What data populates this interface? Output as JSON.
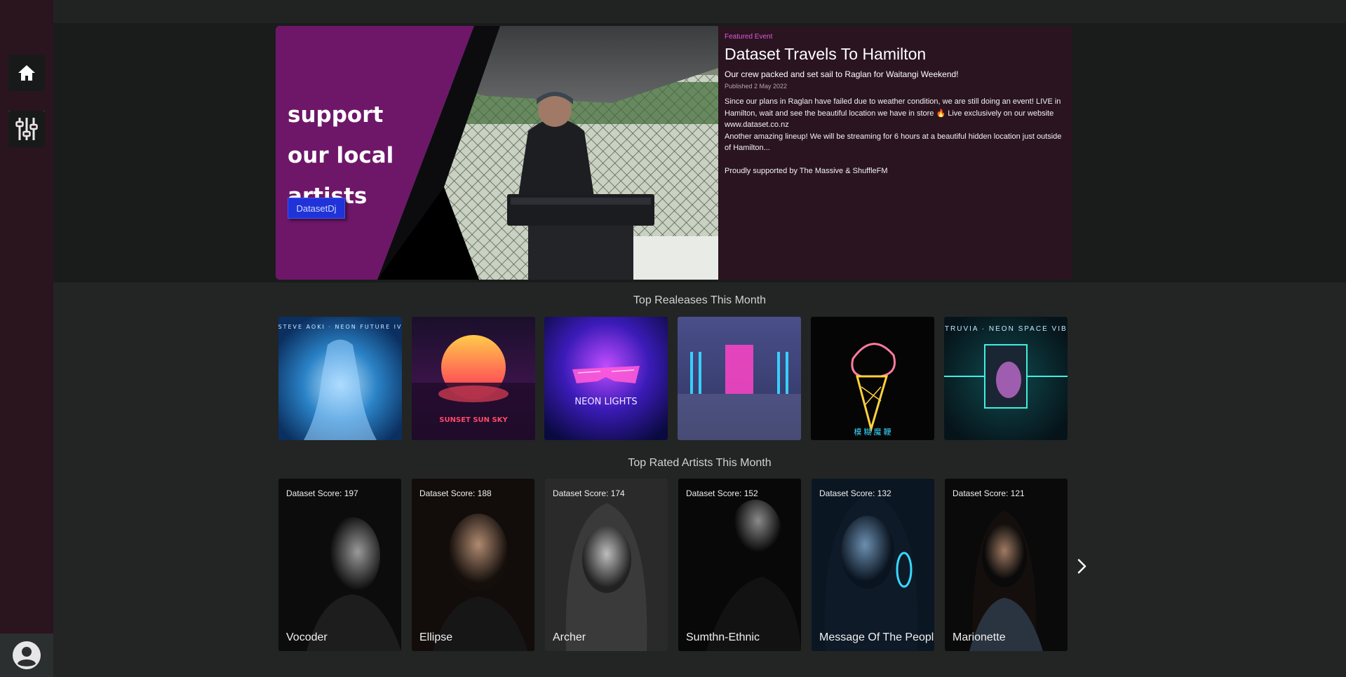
{
  "sidebar": {
    "home_icon": "home-icon",
    "mixer_icon": "sliders-icon",
    "account_icon": "user-avatar-icon"
  },
  "hero": {
    "slogan": [
      "support",
      "our local",
      "artists"
    ],
    "tag_label": "DatasetDj",
    "kicker": "Featured Event",
    "title": "Dataset Travels To Hamilton",
    "subtitle": "Our crew packed and set sail to Raglan for Waitangi Weekend!",
    "date": "Published 2 May 2022",
    "body_line1": "Since our plans in Raglan have failed due to weather condition, we are still doing an event! LIVE in Hamilton, wait and see the beautiful location we have in store 🔥 Live exclusively on our website www.dataset.co.nz",
    "body_line2": "Another amazing lineup! We will be streaming for 6 hours at a beautiful hidden location just outside of Hamilton...",
    "body_line3": "Proudly supported by The Massive & ShuffleFM"
  },
  "releases": {
    "title": "Top Realeases This Month",
    "items": [
      {
        "art_text": "STEVE AOKI · NEON FUTURE IV"
      },
      {
        "art_text": "SUNSET SUN SKY"
      },
      {
        "art_text": "NEON LIGHTS"
      },
      {
        "art_text": ""
      },
      {
        "art_text": "模 糊 魔 鞭"
      },
      {
        "art_text": "ENTRUVIA · NEON SPACE VIBES"
      }
    ]
  },
  "artists": {
    "title": "Top Rated Artists This Month",
    "items": [
      {
        "score": "Dataset Score: 197",
        "name": "Vocoder"
      },
      {
        "score": "Dataset Score: 188",
        "name": "Ellipse"
      },
      {
        "score": "Dataset Score: 174",
        "name": "Archer"
      },
      {
        "score": "Dataset Score: 152",
        "name": "Sumthn-Ethnic"
      },
      {
        "score": "Dataset Score: 132",
        "name": "Message Of The People"
      },
      {
        "score": "Dataset Score: 121",
        "name": "Marionette"
      }
    ],
    "next_icon": "chevron-right-icon"
  },
  "colors": {
    "sidebar": "#2a141e",
    "hero_card": "#2a1420",
    "hero_purple": "#6e1769",
    "accent_pink": "#e05cd8",
    "tag_blue": "#1f33d8"
  }
}
